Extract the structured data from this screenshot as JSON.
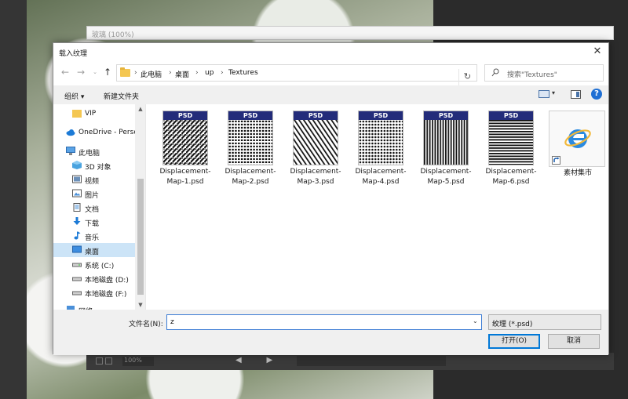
{
  "background": {
    "document_title": "玻璃 (100%)",
    "zoom": "100%"
  },
  "dialog": {
    "title": "载入纹理",
    "close_glyph": "✕"
  },
  "address": {
    "breadcrumbs": [
      "此电脑",
      "桌面",
      "up",
      "Textures"
    ]
  },
  "search": {
    "placeholder": "搜索\"Textures\""
  },
  "toolbar": {
    "organize_label": "组织 ▾",
    "new_folder_label": "新建文件夹",
    "help_label": "?"
  },
  "sidebar": {
    "items": [
      {
        "label": "VIP",
        "icon": "folder-icon"
      },
      {
        "label": "OneDrive - Perso",
        "icon": "cloud-icon"
      },
      {
        "label": "此电脑",
        "icon": "computer-icon"
      },
      {
        "label": "3D 对象",
        "icon": "3d-objects-icon"
      },
      {
        "label": "视频",
        "icon": "video-icon"
      },
      {
        "label": "图片",
        "icon": "pictures-icon"
      },
      {
        "label": "文档",
        "icon": "documents-icon"
      },
      {
        "label": "下载",
        "icon": "download-icon"
      },
      {
        "label": "音乐",
        "icon": "music-icon"
      },
      {
        "label": "桌面",
        "icon": "desktop-icon"
      },
      {
        "label": "系统 (C:)",
        "icon": "drive-icon"
      },
      {
        "label": "本地磁盘 (D:)",
        "icon": "drive-icon"
      },
      {
        "label": "本地磁盘 (F:)",
        "icon": "drive-icon"
      },
      {
        "label": "网络",
        "icon": "network-icon"
      }
    ]
  },
  "files": [
    {
      "name_line1": "Displacement-",
      "name_line2": "Map-1.psd",
      "header": "PSD",
      "pattern": "diagonal-weave"
    },
    {
      "name_line1": "Displacement-",
      "name_line2": "Map-2.psd",
      "header": "PSD",
      "pattern": "dots"
    },
    {
      "name_line1": "Displacement-",
      "name_line2": "Map-3.psd",
      "header": "PSD",
      "pattern": "diagonal-lines"
    },
    {
      "name_line1": "Displacement-",
      "name_line2": "Map-4.psd",
      "header": "PSD",
      "pattern": "grid-dots"
    },
    {
      "name_line1": "Displacement-",
      "name_line2": "Map-5.psd",
      "header": "PSD",
      "pattern": "vertical-lines"
    },
    {
      "name_line1": "Displacement-",
      "name_line2": "Map-6.psd",
      "header": "PSD",
      "pattern": "horizontal-lines"
    }
  ],
  "shortcut": {
    "name": "素材集市",
    "icon": "internet-explorer-icon"
  },
  "bottom": {
    "filename_label": "文件名(N):",
    "filename_value": "z",
    "filetype_value": "纹理 (*.psd)",
    "open_label": "打开(O)",
    "cancel_label": "取消"
  },
  "colors": {
    "accent": "#0078d7",
    "selected": "#cce4f7",
    "psd_header": "#232c7a",
    "folder": "#f4c752"
  }
}
